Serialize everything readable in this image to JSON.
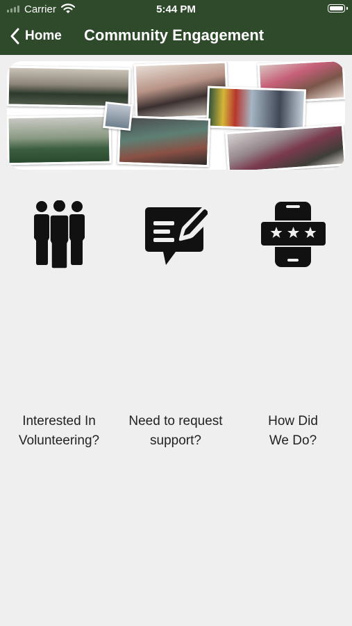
{
  "status_bar": {
    "carrier": "Carrier",
    "time": "5:44 PM"
  },
  "nav": {
    "back_label": "Home",
    "title": "Community Engagement"
  },
  "banner": {
    "type": "photo-collage",
    "photo_count": 8
  },
  "options": [
    {
      "icon": "group-people-icon",
      "line1": "Interested In",
      "line2": "Volunteering?"
    },
    {
      "icon": "edit-message-icon",
      "line1": "Need to request",
      "line2": "support?"
    },
    {
      "icon": "phone-rating-icon",
      "line1": "How Did",
      "line2": "We Do?"
    }
  ],
  "colors": {
    "header": "#2e4a2b",
    "background": "#efefef",
    "icon": "#111111"
  }
}
